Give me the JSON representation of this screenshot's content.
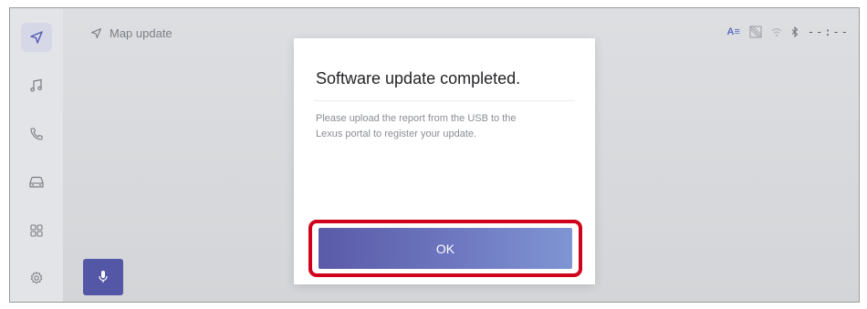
{
  "header": {
    "title": "Map update",
    "title_icon": "navigation-arrow-icon"
  },
  "status_bar": {
    "text_size_label": "A≡",
    "clock": "--:--"
  },
  "sidebar": {
    "items": [
      {
        "icon": "navigation-icon",
        "active": true
      },
      {
        "icon": "music-icon"
      },
      {
        "icon": "phone-icon"
      },
      {
        "icon": "car-icon"
      },
      {
        "icon": "apps-grid-icon"
      },
      {
        "icon": "settings-gear-icon"
      }
    ]
  },
  "dialog": {
    "title": "Software update completed.",
    "body": "Please upload the report from the USB to the Lexus portal to register your update.",
    "ok_label": "OK"
  },
  "colors": {
    "accent": "#5456a6",
    "highlight": "#d0021b"
  }
}
